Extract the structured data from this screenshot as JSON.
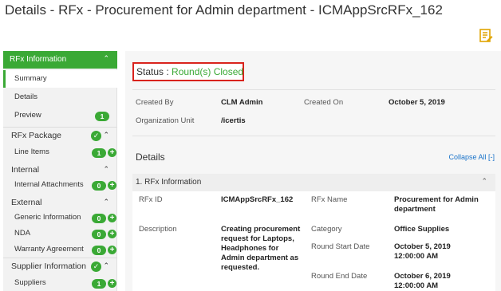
{
  "page": {
    "title": "Details - RFx - Procurement for Admin department - ICMAppSrcRFx_162"
  },
  "sidebar": {
    "rfx_info": {
      "label": "RFx Information",
      "items": [
        {
          "label": "Summary"
        },
        {
          "label": "Details"
        },
        {
          "label": "Preview",
          "badge": "1"
        }
      ]
    },
    "rfx_package": {
      "label": "RFx Package",
      "items": [
        {
          "label": "Line Items",
          "badge": "1"
        }
      ]
    },
    "internal": {
      "label": "Internal",
      "items": [
        {
          "label": "Internal Attachments",
          "badge": "0"
        }
      ]
    },
    "external": {
      "label": "External",
      "items": [
        {
          "label": "Generic Information",
          "badge": "0"
        },
        {
          "label": "NDA",
          "badge": "0"
        },
        {
          "label": "Warranty Agreement",
          "badge": "0"
        }
      ]
    },
    "supplier_info": {
      "label": "Supplier Information",
      "items": [
        {
          "label": "Suppliers",
          "badge": "1"
        }
      ]
    }
  },
  "status": {
    "label": "Status :",
    "value": "Round(s) Closed"
  },
  "meta": {
    "created_by_label": "Created By",
    "created_by": "CLM Admin",
    "created_on_label": "Created On",
    "created_on": "October 5, 2019",
    "org_unit_label": "Organization Unit",
    "org_unit": "/icertis"
  },
  "details": {
    "title": "Details",
    "collapse": "Collapse All [-]",
    "section": "1. RFx Information",
    "rfx_id_label": "RFx ID",
    "rfx_id": "ICMAppSrcRFx_162",
    "rfx_name_label": "RFx Name",
    "rfx_name": "Procurement for Admin department",
    "description_label": "Description",
    "description": "Creating procurement request for Laptops, Headphones for Admin department as requested.",
    "category_label": "Category",
    "category": "Office Supplies",
    "start_label": "Round Start Date",
    "start": "October 5, 2019 12:00:00 AM",
    "end_label": "Round End Date",
    "end": "October 6, 2019 12:00:00 AM"
  }
}
